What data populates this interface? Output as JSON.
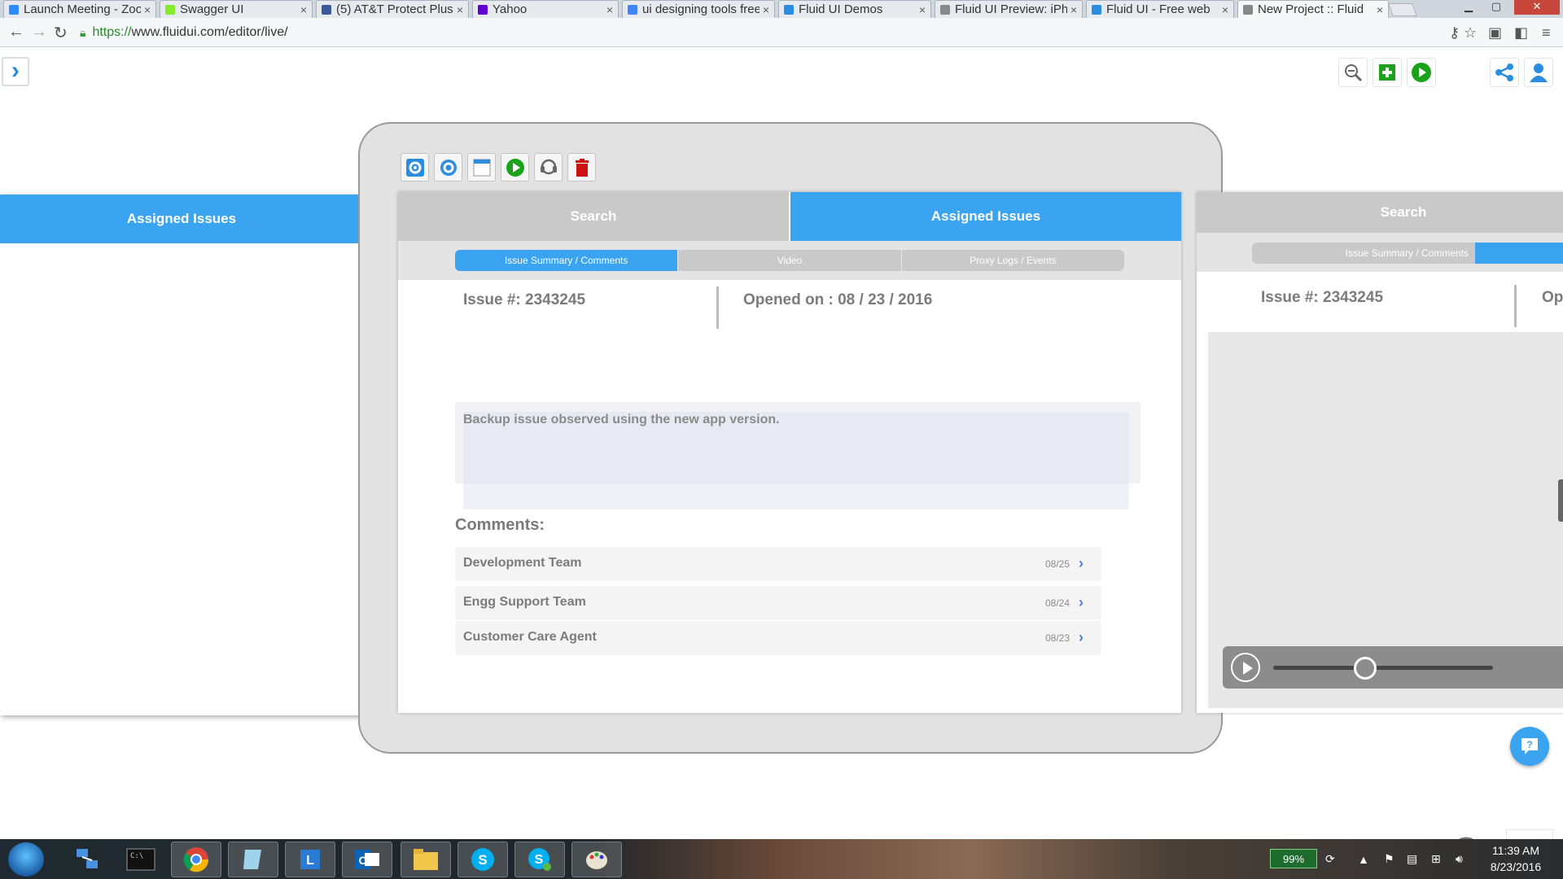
{
  "browser": {
    "tabs": [
      {
        "title": "Launch Meeting - Zoom",
        "fav_color": "#2d8cff"
      },
      {
        "title": "Swagger UI",
        "fav_color": "#85ea2d"
      },
      {
        "title": "(5) AT&T Protect Plus",
        "fav_color": "#3b5998"
      },
      {
        "title": "Yahoo",
        "fav_color": "#5f01d1"
      },
      {
        "title": "ui designing tools free",
        "fav_color": "#4285f4"
      },
      {
        "title": "Fluid UI Demos",
        "fav_color": "#2b8de0"
      },
      {
        "title": "Fluid UI Preview: iPhone",
        "fav_color": "#888888"
      },
      {
        "title": "Fluid UI - Free web",
        "fav_color": "#2b8de0"
      },
      {
        "title": "New Project :: Fluid",
        "fav_color": "#888888"
      }
    ],
    "tab_close": "×",
    "url_scheme": "https://",
    "url_rest": "www.fluidui.com/editor/live/"
  },
  "editor": {
    "colors": {
      "accent": "#3aa4f0",
      "gray_tab": "#c9c9c9",
      "danger": "#cc1111",
      "go": "#1aa31a"
    }
  },
  "left_screen": {
    "header": "Assigned Issues"
  },
  "center_screen": {
    "nav": {
      "left": "Search",
      "right": "Assigned Issues"
    },
    "subtabs": [
      "Issue Summary / Comments",
      "Video",
      "Proxy Logs / Events"
    ],
    "issue_label": "Issue #: 2343245",
    "opened_label": "Opened on : 08 / 23 / 2016",
    "description": "Backup issue observed using the new app version.",
    "comments_title": "Comments:",
    "comments": [
      {
        "name": "Development Team",
        "date": "08/25"
      },
      {
        "name": "Engg Support Team",
        "date": "08/24"
      },
      {
        "name": "Customer Care Agent",
        "date": "08/23"
      }
    ]
  },
  "right_screen": {
    "nav": "Search",
    "subtab": "Issue Summary / Comments",
    "issue_label": "Issue #: 2343245",
    "opened_partial": "Op",
    "video_progress": 0.42
  },
  "taskbar": {
    "battery": "99%",
    "time": "11:39 AM",
    "date": "8/23/2016"
  }
}
